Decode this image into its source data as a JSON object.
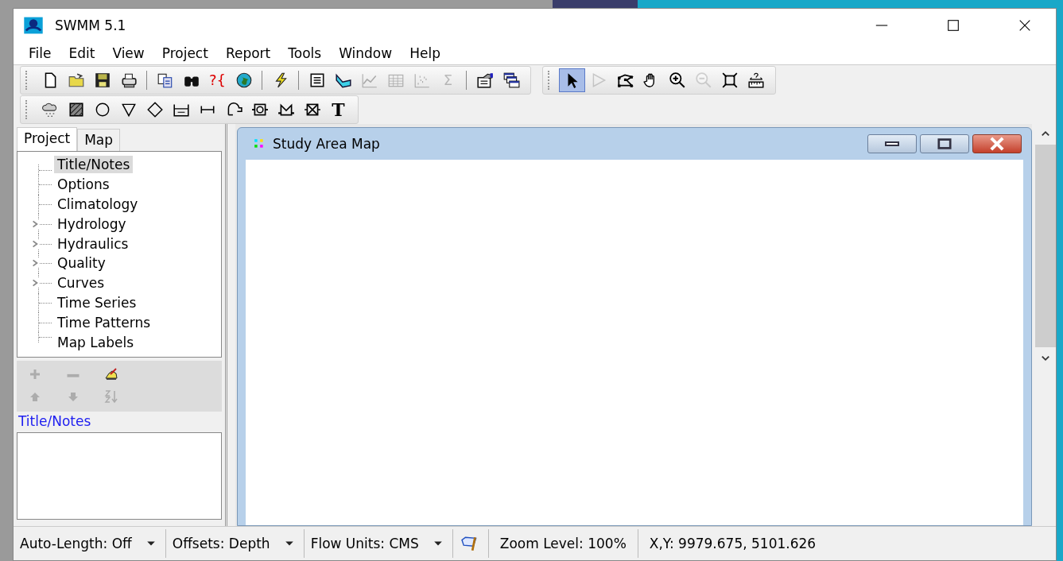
{
  "window": {
    "title": "SWMM 5.1"
  },
  "menu": [
    "File",
    "Edit",
    "View",
    "Project",
    "Report",
    "Tools",
    "Window",
    "Help"
  ],
  "toolbars": [
    {
      "groups": [
        [
          {
            "kind": "new-file",
            "disabled": false
          },
          {
            "kind": "folder",
            "disabled": false
          },
          {
            "kind": "floppy-disk",
            "disabled": false
          },
          {
            "kind": "printer",
            "disabled": false
          }
        ],
        [
          {
            "kind": "copy",
            "disabled": false
          },
          {
            "kind": "binoculars",
            "disabled": false
          },
          {
            "kind": "text",
            "glyph": "?{",
            "disabled": false
          },
          {
            "kind": "globe",
            "disabled": false
          }
        ],
        [
          {
            "kind": "lightning",
            "disabled": false
          }
        ],
        [
          {
            "kind": "document",
            "disabled": false
          },
          {
            "kind": "profile",
            "disabled": false
          },
          {
            "kind": "line-chart",
            "disabled": true
          },
          {
            "kind": "table",
            "disabled": true
          },
          {
            "kind": "scatter",
            "disabled": true
          },
          {
            "kind": "text",
            "glyph": "Σ",
            "disabled": true
          }
        ],
        [
          {
            "kind": "options",
            "disabled": false
          },
          {
            "kind": "windows",
            "disabled": false
          }
        ]
      ]
    },
    {
      "groups": [
        [
          {
            "kind": "pointer",
            "disabled": false,
            "selected": true
          },
          {
            "kind": "vertex-pointer",
            "disabled": true,
            "selected": false
          },
          {
            "kind": "polygon",
            "disabled": false,
            "selected": false
          },
          {
            "kind": "hand",
            "disabled": false,
            "selected": false
          },
          {
            "kind": "zoom-in",
            "disabled": false,
            "selected": false
          },
          {
            "kind": "zoom-out",
            "disabled": true,
            "selected": false
          },
          {
            "kind": "full-extent",
            "disabled": false,
            "selected": false
          },
          {
            "kind": "ruler",
            "disabled": false,
            "selected": false
          }
        ]
      ]
    },
    {
      "groups": [
        [
          {
            "kind": "cloud",
            "disabled": false
          },
          {
            "kind": "hatched-square",
            "disabled": false
          },
          {
            "kind": "circle",
            "disabled": false
          },
          {
            "kind": "triangle",
            "disabled": false
          },
          {
            "kind": "diamond",
            "disabled": false
          },
          {
            "kind": "storage",
            "disabled": false
          },
          {
            "kind": "conduit",
            "disabled": false
          },
          {
            "kind": "pump",
            "disabled": false
          },
          {
            "kind": "orifice",
            "disabled": false
          },
          {
            "kind": "weir",
            "disabled": false
          },
          {
            "kind": "outlet",
            "disabled": false
          },
          {
            "kind": "text",
            "glyph": "T",
            "disabled": false
          }
        ]
      ]
    }
  ],
  "left_panel": {
    "tabs": [
      {
        "label": "Project",
        "selected": true
      },
      {
        "label": "Map",
        "selected": false
      }
    ],
    "tree": [
      {
        "label": "Title/Notes",
        "kind": "leaf",
        "selected": true
      },
      {
        "label": "Options",
        "kind": "leaf",
        "selected": false
      },
      {
        "label": "Climatology",
        "kind": "leaf",
        "selected": false
      },
      {
        "label": "Hydrology",
        "kind": "group",
        "expanded": false,
        "selected": false
      },
      {
        "label": "Hydraulics",
        "kind": "group",
        "expanded": false,
        "selected": false
      },
      {
        "label": "Quality",
        "kind": "group",
        "expanded": false,
        "selected": false
      },
      {
        "label": "Curves",
        "kind": "group",
        "expanded": false,
        "selected": false
      },
      {
        "label": "Time Series",
        "kind": "leaf",
        "selected": false
      },
      {
        "label": "Time Patterns",
        "kind": "leaf",
        "selected": false
      },
      {
        "label": "Map Labels",
        "kind": "leaf",
        "selected": false
      }
    ],
    "tools": [
      [
        {
          "kind": "plus",
          "disabled": true
        },
        {
          "kind": "minus",
          "disabled": true
        },
        {
          "kind": "edit-hand",
          "disabled": false
        }
      ],
      [
        {
          "kind": "arrow-up",
          "disabled": true
        },
        {
          "kind": "arrow-down",
          "disabled": true
        },
        {
          "kind": "sort",
          "disabled": true
        }
      ]
    ],
    "caption": "Title/Notes"
  },
  "map_window": {
    "title": "Study Area Map"
  },
  "status_bar": [
    {
      "kind": "dropdown",
      "text": "Auto-Length: Off"
    },
    {
      "kind": "dropdown",
      "text": "Offsets: Depth"
    },
    {
      "kind": "dropdown",
      "text": "Flow Units: CMS"
    },
    {
      "kind": "icon"
    },
    {
      "kind": "text",
      "text": "Zoom Level: 100%"
    },
    {
      "kind": "text",
      "text": "X,Y: 9979.675, 5101.626"
    }
  ]
}
